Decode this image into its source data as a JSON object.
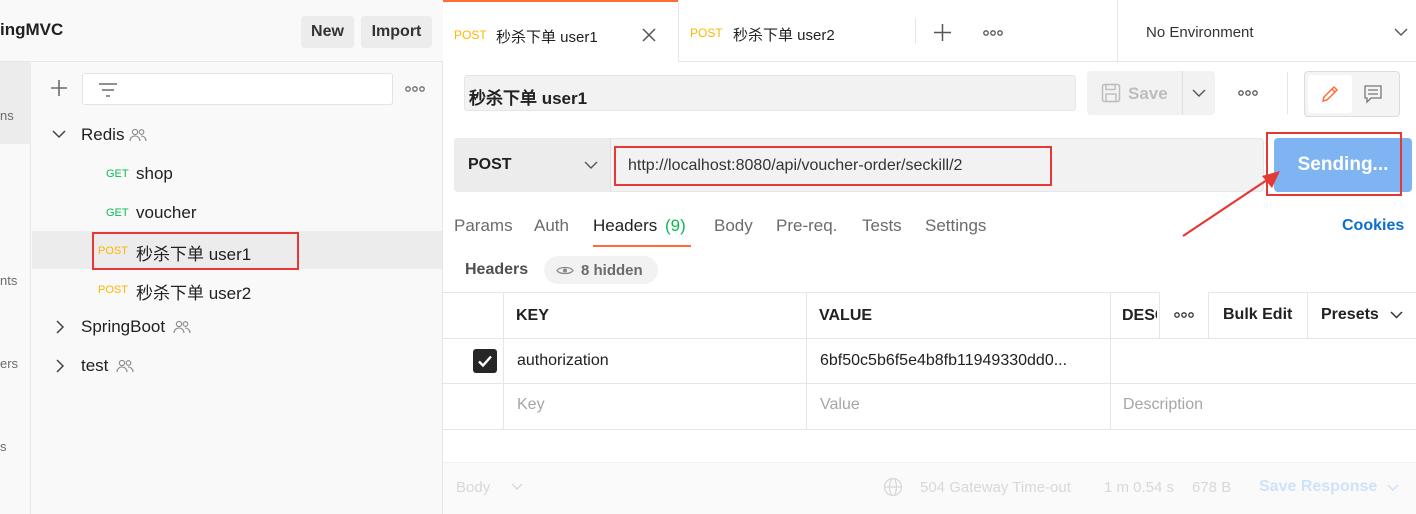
{
  "workspace": {
    "title": "ingMVC",
    "new_label": "New",
    "import_label": "Import"
  },
  "sidebar_strip": {
    "labels": [
      "ns",
      "nts",
      "ers",
      "s"
    ]
  },
  "collections": {
    "folders": [
      {
        "name": "Redis",
        "expanded": true
      },
      {
        "name": "SpringBoot",
        "expanded": false
      },
      {
        "name": "test",
        "expanded": false
      }
    ],
    "requests": [
      {
        "method": "GET",
        "name": "shop"
      },
      {
        "method": "GET",
        "name": "voucher"
      },
      {
        "method": "POST",
        "name": "秒杀下单 user1"
      },
      {
        "method": "POST",
        "name": "秒杀下单 user2"
      }
    ]
  },
  "tabs": [
    {
      "method": "POST",
      "name": "秒杀下单 user1"
    },
    {
      "method": "POST",
      "name": "秒杀下单 user2"
    }
  ],
  "environment": "No Environment",
  "request": {
    "name": "秒杀下单 user1",
    "save_label": "Save",
    "method": "POST",
    "url": "http://localhost:8080/api/voucher-order/seckill/2",
    "send_label": "Sending..."
  },
  "request_tabs": {
    "params": "Params",
    "auth": "Auth",
    "headers": "Headers",
    "headers_count": "(9)",
    "body": "Body",
    "prereq": "Pre-req.",
    "tests": "Tests",
    "settings": "Settings",
    "cookies": "Cookies"
  },
  "headers_section": {
    "title": "Headers",
    "hidden_label": "8 hidden"
  },
  "headers_table": {
    "columns": {
      "key": "KEY",
      "value": "VALUE",
      "description": "DESC"
    },
    "bulk_edit": "Bulk Edit",
    "presets": "Presets",
    "rows": [
      {
        "checked": true,
        "key": "authorization",
        "value": "6bf50c5b6f5e4b8fb11949330dd0..."
      }
    ],
    "placeholders": {
      "key": "Key",
      "value": "Value",
      "description": "Description"
    }
  },
  "response": {
    "body_label": "Body",
    "status": "504 Gateway Time-out",
    "time": "1 m 0.54 s",
    "size": "678 B",
    "save_response": "Save Response"
  },
  "colors": {
    "accent_orange": "#ff6c37",
    "send_blue": "#7fb4f3",
    "get_green": "#0cbb52",
    "post_yellow": "#ffb400",
    "annotation_red": "#e53935",
    "link_blue": "#0b6ed1"
  }
}
